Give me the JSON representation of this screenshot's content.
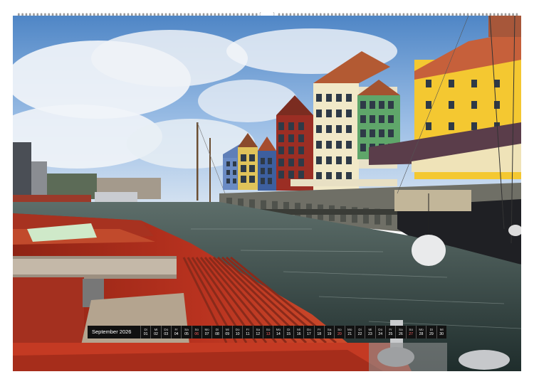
{
  "calendar": {
    "month_label": "September 2026",
    "days": [
      {
        "dn": "Di",
        "num": "01"
      },
      {
        "dn": "Mi",
        "num": "02"
      },
      {
        "dn": "Do",
        "num": "03"
      },
      {
        "dn": "Fr",
        "num": "04"
      },
      {
        "dn": "Sa",
        "num": "05"
      },
      {
        "dn": "So",
        "num": "06"
      },
      {
        "dn": "Mo",
        "num": "07"
      },
      {
        "dn": "Di",
        "num": "08"
      },
      {
        "dn": "Mi",
        "num": "09"
      },
      {
        "dn": "Do",
        "num": "10"
      },
      {
        "dn": "Fr",
        "num": "11"
      },
      {
        "dn": "Sa",
        "num": "12"
      },
      {
        "dn": "So",
        "num": "13"
      },
      {
        "dn": "Mo",
        "num": "14"
      },
      {
        "dn": "Di",
        "num": "15"
      },
      {
        "dn": "Mi",
        "num": "16"
      },
      {
        "dn": "Do",
        "num": "17"
      },
      {
        "dn": "Fr",
        "num": "18"
      },
      {
        "dn": "Sa",
        "num": "19"
      },
      {
        "dn": "So",
        "num": "20"
      },
      {
        "dn": "Mo",
        "num": "21"
      },
      {
        "dn": "Di",
        "num": "22"
      },
      {
        "dn": "Mi",
        "num": "23"
      },
      {
        "dn": "Do",
        "num": "24"
      },
      {
        "dn": "Fr",
        "num": "25"
      },
      {
        "dn": "Sa",
        "num": "26"
      },
      {
        "dn": "So",
        "num": "27"
      },
      {
        "dn": "Mo",
        "num": "28"
      },
      {
        "dn": "Di",
        "num": "29"
      },
      {
        "dn": "Mi",
        "num": "30"
      }
    ],
    "sunday_color": "#ff6464"
  },
  "colors": {
    "strip_background": "#111111",
    "boat_red": "#b8321f"
  }
}
